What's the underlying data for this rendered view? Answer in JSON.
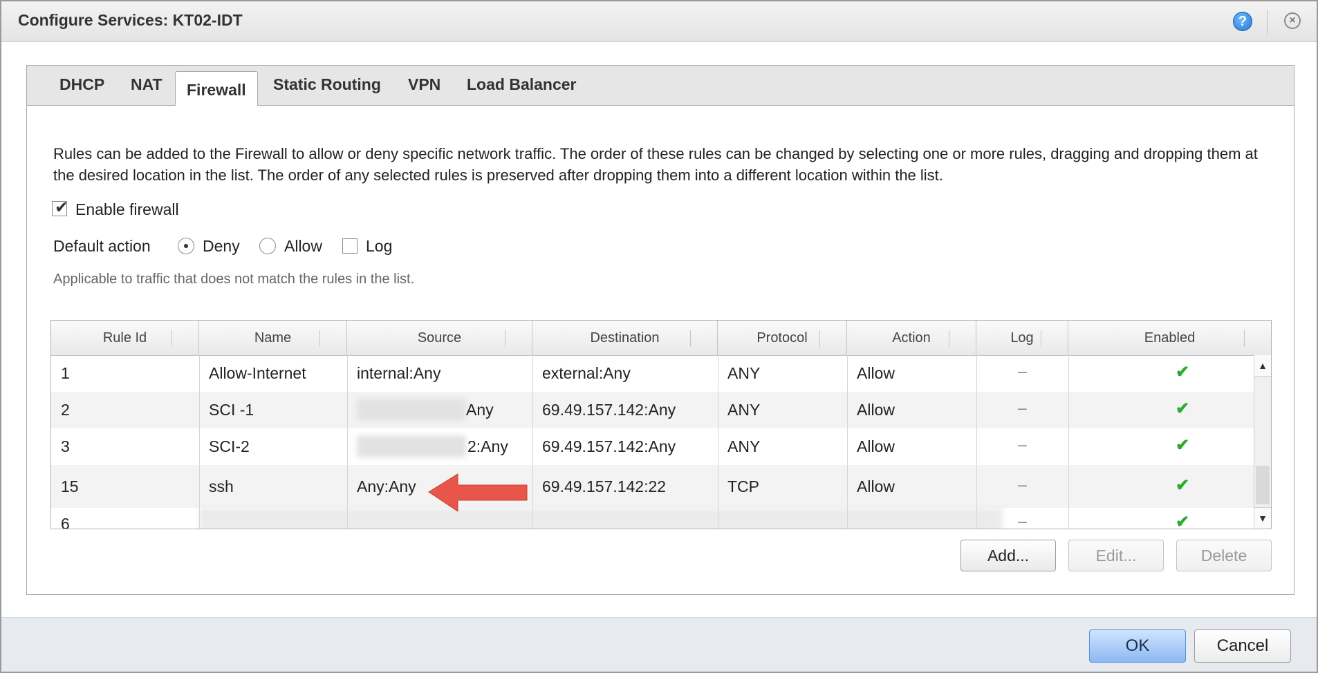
{
  "window": {
    "title": "Configure Services: KT02-IDT",
    "help_icon": "help-icon",
    "close_icon": "close-icon"
  },
  "tabs": [
    {
      "label": "DHCP",
      "active": false
    },
    {
      "label": "NAT",
      "active": false
    },
    {
      "label": "Firewall",
      "active": true
    },
    {
      "label": "Static Routing",
      "active": false
    },
    {
      "label": "VPN",
      "active": false
    },
    {
      "label": "Load Balancer",
      "active": false
    }
  ],
  "firewall": {
    "description": "Rules can be added to the Firewall to allow or deny specific network traffic. The order of these rules can be changed by selecting one or more rules, dragging and dropping them at the desired location in the list. The order of any selected rules is preserved after dropping them into a different location within the list.",
    "enable_label": "Enable firewall",
    "enable_checked": true,
    "default_action_label": "Default action",
    "deny_label": "Deny",
    "allow_label": "Allow",
    "log_label": "Log",
    "default_action_selected": "Deny",
    "log_checked": false,
    "hint": "Applicable to traffic that does not match the rules in the list."
  },
  "table": {
    "columns": [
      "Rule Id",
      "Name",
      "Source",
      "Destination",
      "Protocol",
      "Action",
      "Log",
      "Enabled"
    ],
    "rows": [
      {
        "id": "1",
        "name": "Allow-Internet",
        "source": "internal:Any",
        "destination": "external:Any",
        "protocol": "ANY",
        "action": "Allow",
        "log": "–",
        "enabled": "✔"
      },
      {
        "id": "2",
        "name": "SCI -1",
        "source": "Any",
        "destination": "69.49.157.142:Any",
        "protocol": "ANY",
        "action": "Allow",
        "log": "–",
        "enabled": "✔"
      },
      {
        "id": "3",
        "name": "SCI-2",
        "source": "2:Any",
        "destination": "69.49.157.142:Any",
        "protocol": "ANY",
        "action": "Allow",
        "log": "–",
        "enabled": "✔"
      },
      {
        "id": "15",
        "name": "ssh",
        "source": "Any:Any",
        "destination": "69.49.157.142:22",
        "protocol": "TCP",
        "action": "Allow",
        "log": "–",
        "enabled": "✔"
      },
      {
        "id": "6",
        "name": "",
        "source": "",
        "destination": "",
        "protocol": "",
        "action": "",
        "log": "–",
        "enabled": "✔"
      }
    ]
  },
  "buttons": {
    "add": "Add...",
    "edit": "Edit...",
    "delete": "Delete",
    "ok": "OK",
    "cancel": "Cancel"
  },
  "colors": {
    "accent_blue": "#8eb9f3",
    "check_green": "#2eaa2e",
    "annotation_arrow": "#e8564a"
  }
}
